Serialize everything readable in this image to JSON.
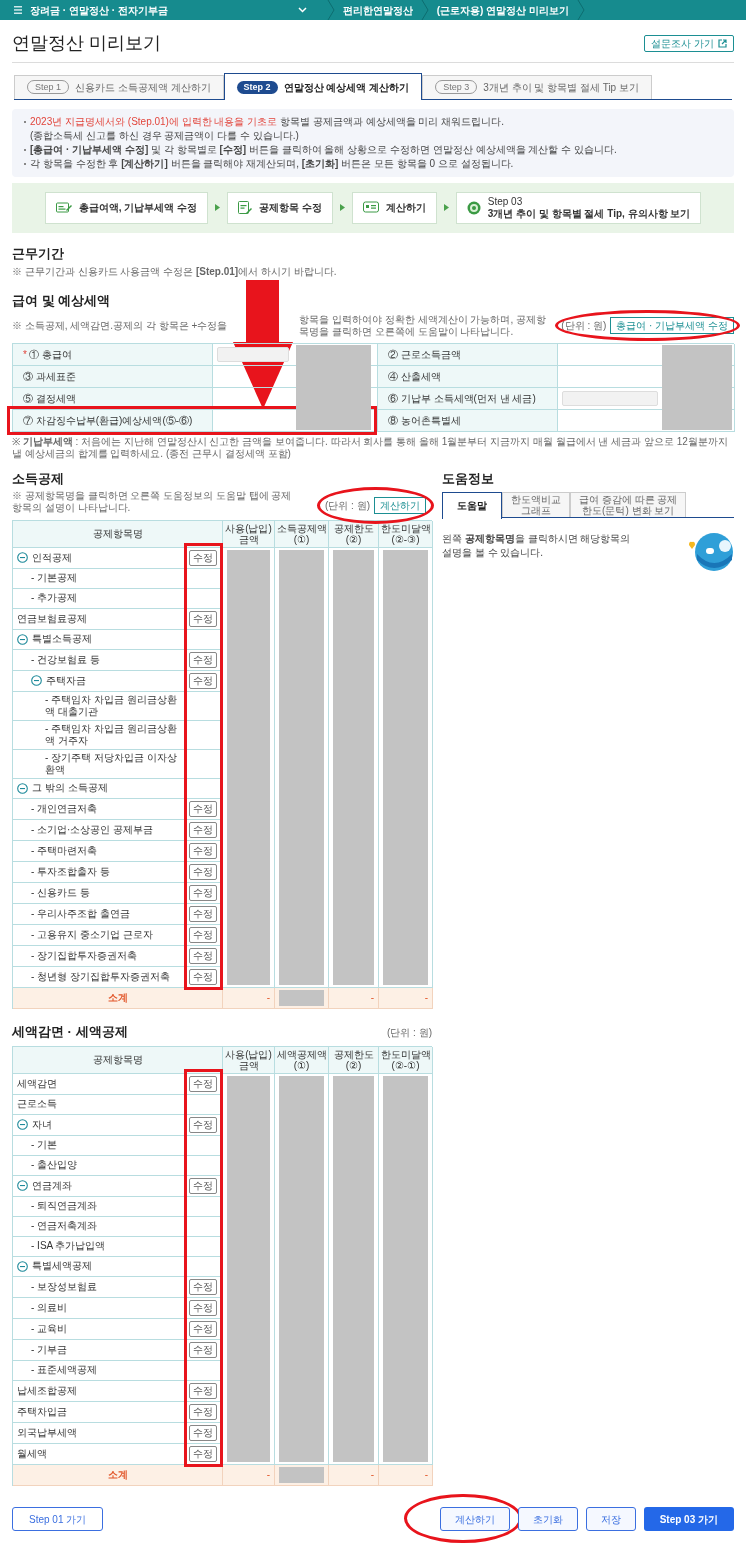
{
  "top_bar": {
    "breadcrumbs": [
      {
        "label": "장려금 · 연말정산 · 전자기부금",
        "dropdown": true
      },
      {
        "label": "편리한연말정산"
      },
      {
        "label": "(근로자용) 연말정산 미리보기"
      }
    ]
  },
  "page_title": "연말정산 미리보기",
  "survey_button": "설문조사 가기",
  "tabs": [
    {
      "step": "Step 1",
      "label": "신용카드 소득공제액 계산하기",
      "selected": false
    },
    {
      "step": "Step 2",
      "label": "연말정산 예상세액 계산하기",
      "selected": true
    },
    {
      "step": "Step 3",
      "label": "3개년 추이 및 항목별 절세 Tip 보기",
      "selected": false
    }
  ],
  "notices": [
    {
      "highlight": "2023년 지급명세서와 (Step.01)에 입력한 내용을 기초로",
      "text": " 항목별 공제금액과 예상세액을 미리 채워드립니다.",
      "sub": "(종합소득세 신고를 하신 경우 공제금액이 다를 수 있습니다.)"
    },
    {
      "text": "**[총급여 · 기납부세액 수정]** 및 각 항목별로 **[수정]** 버튼을 클릭하여 올해 상황으로 수정하면 연말정산 예상세액을 계산할 수 있습니다."
    },
    {
      "text": "각 항목을 수정한 후 **[계산하기]** 버튼을 클릭해야 재계산되며, **[초기화]** 버튼은 모든 항목을 0 으로 설정됩니다."
    }
  ],
  "flow": [
    {
      "kind": "salary",
      "label": "총급여액, 기납부세액 수정"
    },
    {
      "kind": "deduction",
      "label": "공제항목 수정"
    },
    {
      "kind": "calculate",
      "label": "계산하기"
    },
    {
      "kind": "step",
      "title": "Step 03",
      "label": "3개년 추이 및 항목별 절세 Tip, 유의사항 보기"
    }
  ],
  "work_period": {
    "heading": "근무기간",
    "note": "※ 근무기간과 신용카드 사용금액 수정은 **[Step.01]**에서 하시기 바랍니다."
  },
  "salary": {
    "heading": "급여 및 예상세액",
    "note_start": "※ 소득공제, 세액감면.공제의 각 항목은 +수정을",
    "note_end": "항목을 입력하여야 정확한 세액계산이 가능하며, 공제항목명을 클릭하면 오른쪽에 도움말이 나타납니다.",
    "unit": "(단위 : 원)",
    "edit_button": "총급여 · 기납부세액 수정",
    "circled": true,
    "arrow": true,
    "redacted": true,
    "rows": [
      {
        "left": {
          "required_mark": "*",
          "label": "① 총급여",
          "input": true
        },
        "right": {
          "label": "② 근로소득금액"
        }
      },
      {
        "left": {
          "label": "③ 과세표준"
        },
        "right": {
          "label": "④ 산출세액"
        }
      },
      {
        "left": {
          "label": "⑤ 결정세액"
        },
        "right": {
          "label": "⑥ 기납부 소득세액(먼저 낸 세금)",
          "input": true
        }
      },
      {
        "boxed": true,
        "left": {
          "label": "⑦ 차감징수납부(환급)예상세액(⑤-⑥)"
        },
        "right": {
          "label": "⑧ 농어촌특별세"
        }
      }
    ],
    "footnote": "※ **기납부세액** : 처음에는 지난해 연말정산시 신고한 금액을 보여줍니다. 따라서 회사를 통해 올해 1월분부터 지금까지 매월 월급에서 낸 세금과 앞으로 12월분까지 낼 예상세금의 합계를 입력하세요. (종전 근무시 결정세액 포함)"
  },
  "income_deduction": {
    "heading": "소득공제",
    "note": "※ 공제항목명을 클릭하면 오른쪽 도움정보의 도움말 탭에 공제항목의 설명이 나타납니다.",
    "unit": "(단위 : 원)",
    "calc_button": "계산하기",
    "circled": true,
    "table": {
      "edit_column_boxed": true,
      "columns": [
        {
          "label": "공제항목명"
        },
        {
          "label": "사용(납입)금액",
          "redacted": true
        },
        {
          "label": "소득공제액\n(①)",
          "redacted": true
        },
        {
          "label": "공제한도\n(②)",
          "redacted": true
        },
        {
          "label": "한도미달액\n(②-③)",
          "redacted": true
        }
      ],
      "rows": [
        {
          "label": "인적공제",
          "expanded": true,
          "edit": "수정",
          "children": [
            {
              "label": "- 기본공제"
            },
            {
              "label": "- 추가공제"
            }
          ]
        },
        {
          "label": "연금보험료공제",
          "edit": "수정"
        },
        {
          "label": "특별소득공제",
          "expanded": true,
          "children": [
            {
              "label": "- 건강보험료 등",
              "edit": "수정"
            },
            {
              "label": "주택자금",
              "expanded": true,
              "edit": "수정",
              "children": [
                {
                  "label": "- 주택임차 차입금 원리금상환액 대출기관"
                },
                {
                  "label": "- 주택임차 차입금 원리금상환액 거주자"
                },
                {
                  "label": "- 장기주택 저당차입금 이자상환액"
                }
              ]
            }
          ]
        },
        {
          "label": "그 밖의 소득공제",
          "expanded": true,
          "children": [
            {
              "label": "- 개인연금저축",
              "edit": "수정"
            },
            {
              "label": "- 소기업·소상공인 공제부금",
              "edit": "수정"
            },
            {
              "label": "- 주택마련저축",
              "edit": "수정"
            },
            {
              "label": "- 투자조합출자 등",
              "edit": "수정"
            },
            {
              "label": "- 신용카드 등",
              "edit": "수정"
            },
            {
              "label": "- 우리사주조합 출연금",
              "edit": "수정"
            },
            {
              "label": "- 고용유지 중소기업 근로자",
              "edit": "수정"
            },
            {
              "label": "- 장기집합투자증권저축",
              "edit": "수정"
            },
            {
              "label": "- 청년형 장기집합투자증권저축",
              "edit": "수정"
            }
          ]
        }
      ],
      "subtotal": {
        "label": "소계",
        "cells": [
          {
            "text": "-"
          },
          {
            "redacted": true
          },
          {
            "text": "-"
          },
          {
            "text": "-"
          }
        ]
      }
    }
  },
  "help": {
    "heading": "도움정보",
    "tabs": [
      {
        "label": "도움말",
        "selected": true
      },
      {
        "label": "한도액비교\n그래프",
        "selected": false
      },
      {
        "label": "급여 증감에 따른 공제\n한도(문턱) 변화 보기",
        "selected": false
      }
    ],
    "text": "왼쪽 **공제항목명**을 클릭하시면 해당항목의\n설명을 볼 수 있습니다."
  },
  "tax_credit": {
    "heading": "세액감면 · 세액공제",
    "unit": "(단위 : 원)",
    "table": {
      "edit_column_boxed": true,
      "columns": [
        {
          "label": "공제항목명"
        },
        {
          "label": "사용(납입)금액",
          "redacted": true
        },
        {
          "label": "세액공제액\n(①)",
          "redacted": true
        },
        {
          "label": "공제한도\n(②)",
          "redacted": true
        },
        {
          "label": "한도미달액\n(②-①)",
          "redacted": true
        }
      ],
      "rows": [
        {
          "label": "세액감면",
          "edit": "수정"
        },
        {
          "label": "근로소득"
        },
        {
          "label": "자녀",
          "expanded": true,
          "edit": "수정",
          "children": [
            {
              "label": "- 기본"
            },
            {
              "label": "- 출산입양"
            }
          ]
        },
        {
          "label": "연금계좌",
          "expanded": true,
          "edit": "수정",
          "children": [
            {
              "label": "- 퇴직연금계좌"
            },
            {
              "label": "- 연금저축계좌"
            },
            {
              "label": "- ISA 추가납입액"
            }
          ]
        },
        {
          "label": "특별세액공제",
          "expanded": true,
          "children": [
            {
              "label": "- 보장성보험료",
              "edit": "수정"
            },
            {
              "label": "- 의료비",
              "edit": "수정"
            },
            {
              "label": "- 교육비",
              "edit": "수정"
            },
            {
              "label": "- 기부금",
              "edit": "수정"
            },
            {
              "label": "- 표준세액공제"
            }
          ]
        },
        {
          "label": "납세조합공제",
          "edit": "수정"
        },
        {
          "label": "주택차입금",
          "edit": "수정"
        },
        {
          "label": "외국납부세액",
          "edit": "수정"
        },
        {
          "label": "월세액",
          "edit": "수정"
        }
      ],
      "subtotal": {
        "label": "소계",
        "cells": [
          {
            "text": "-"
          },
          {
            "redacted": true
          },
          {
            "text": "-"
          },
          {
            "text": "-"
          }
        ]
      }
    }
  },
  "buttons": [
    {
      "label": "Step 01 가기",
      "kind": "outline"
    },
    {
      "label": "계산하기",
      "kind": "light",
      "circled": true
    },
    {
      "label": "초기화",
      "kind": "light"
    },
    {
      "label": "저장",
      "kind": "light"
    },
    {
      "label": "Step 03 가기",
      "kind": "primary"
    }
  ]
}
